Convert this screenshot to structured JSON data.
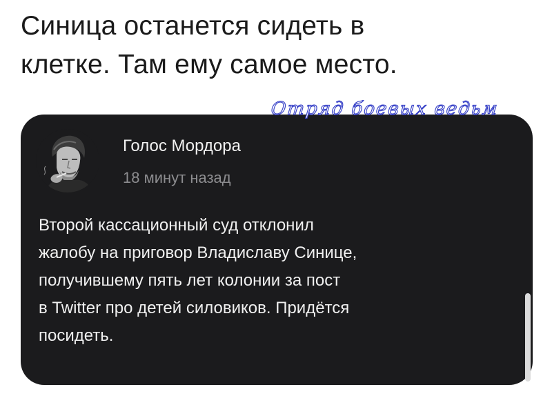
{
  "headline": {
    "line1": "Синица останется сидеть в",
    "line2": "клетке. Там ему самое место."
  },
  "post": {
    "author": "Голос Мордора",
    "time": "18 минут назад",
    "lines": [
      "Второй кассационный суд отклонил",
      "жалобу на приговор Владиславу Синице,",
      "получившему пять лет колонии за пост",
      "в Twitter про детей силовиков. Придётся",
      "посидеть."
    ]
  },
  "watermark": "Отряд боевых ведьм",
  "colors": {
    "card_background": "#1b1b1d",
    "page_background": "#ffffff",
    "watermark_outline": "#3a44c8",
    "muted_text": "#8d8d90"
  },
  "icons": {
    "avatar": "avatar-photo-man-smoking"
  }
}
